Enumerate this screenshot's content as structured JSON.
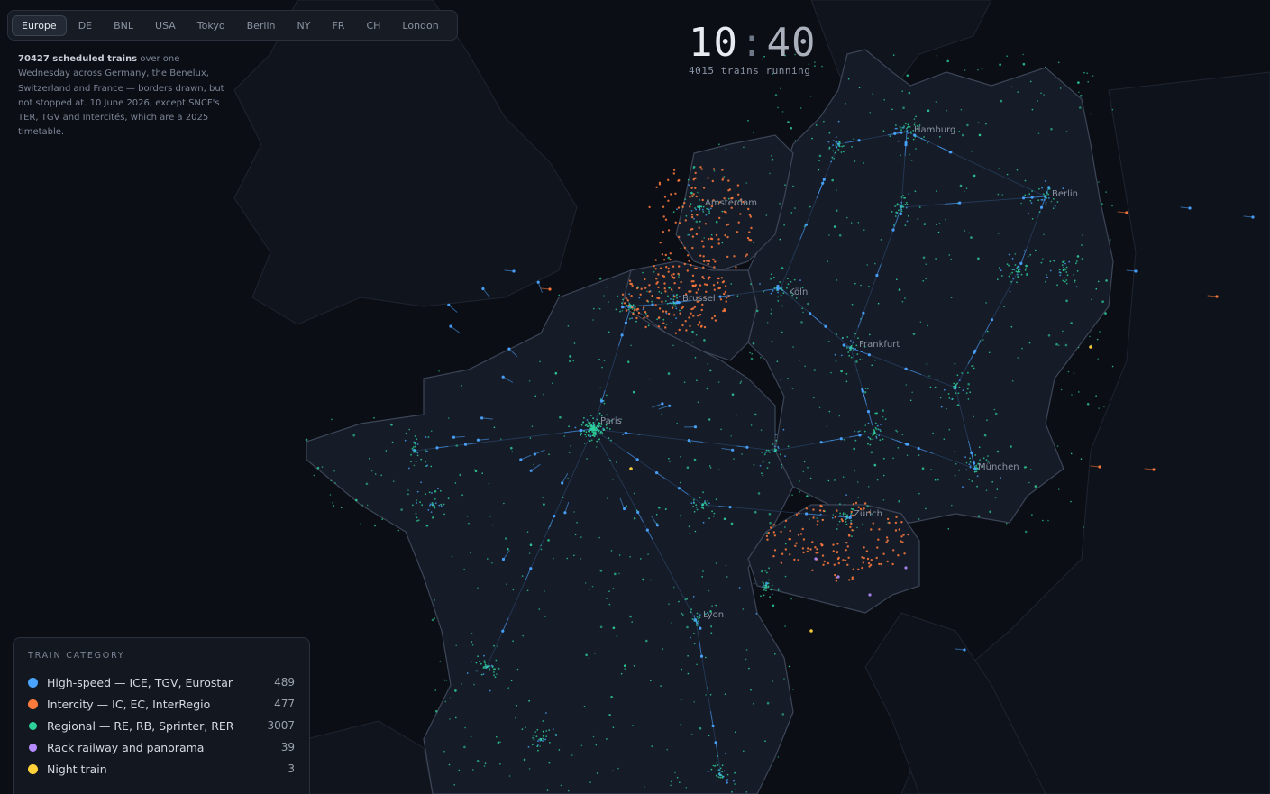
{
  "tabs": [
    {
      "label": "Europe",
      "active": true
    },
    {
      "label": "DE",
      "active": false
    },
    {
      "label": "BNL",
      "active": false
    },
    {
      "label": "USA",
      "active": false
    },
    {
      "label": "Tokyo",
      "active": false
    },
    {
      "label": "Berlin",
      "active": false
    },
    {
      "label": "NY",
      "active": false
    },
    {
      "label": "FR",
      "active": false
    },
    {
      "label": "CH",
      "active": false
    },
    {
      "label": "London",
      "active": false
    }
  ],
  "intro": {
    "count": "70427 scheduled trains",
    "text": " over one Wednesday across Germany, the Benelux, Switzerland and France — borders drawn, but not stopped at. 10 June 2026, except SNCF's TER, TGV and Intercités, which are a 2025 timetable."
  },
  "clock": {
    "hours": "10",
    "minutes": "40",
    "running": "4015 trains running"
  },
  "legend": {
    "title": "TRAIN CATEGORY",
    "items": [
      {
        "label": "High-speed — ICE, TGV, Eurostar",
        "count": "489",
        "color": "#4aa3ff"
      },
      {
        "label": "Intercity — IC, EC, InterRegio",
        "count": "477",
        "color": "#ff7a3d"
      },
      {
        "label": "Regional — RE, RB, Sprinter, RER",
        "count": "3007",
        "color": "#2ed19a"
      },
      {
        "label": "Rack railway and panorama",
        "count": "39",
        "color": "#b48cff"
      },
      {
        "label": "Night train",
        "count": "3",
        "color": "#ffd23a"
      }
    ]
  },
  "cities": [
    {
      "name": "Hamburg"
    },
    {
      "name": "Berlin"
    },
    {
      "name": "Amsterdam"
    },
    {
      "name": "Brussel"
    },
    {
      "name": "Köln"
    },
    {
      "name": "Frankfurt"
    },
    {
      "name": "Paris"
    },
    {
      "name": "München"
    },
    {
      "name": "Zürich"
    },
    {
      "name": "Lyon"
    }
  ]
}
